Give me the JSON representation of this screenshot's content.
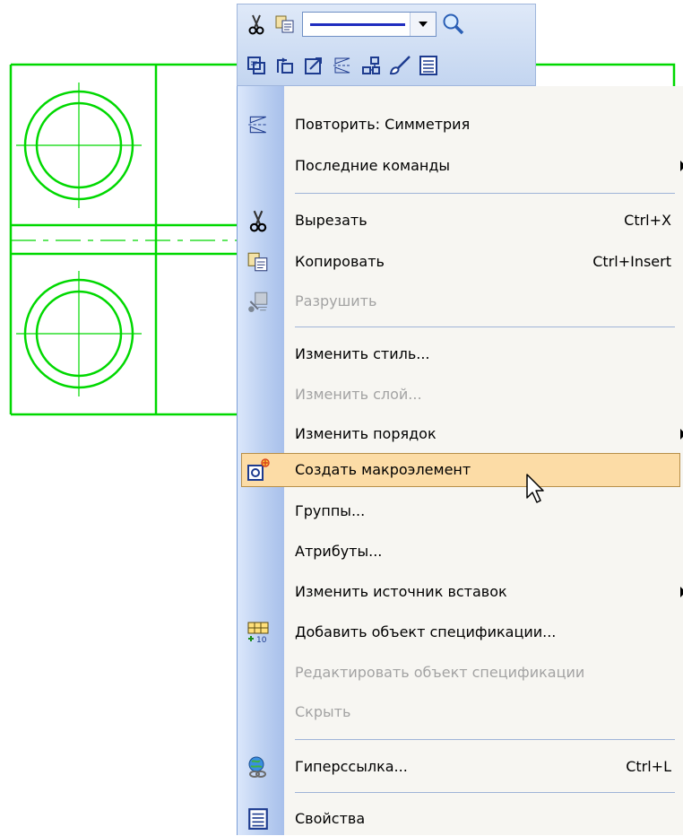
{
  "colors": {
    "drawing_line": "#00d800",
    "menu_background": "#f7f6f2",
    "gutter": "#bcd0f1",
    "highlight": "#fcdca6",
    "highlight_border": "#b78f4a",
    "disabled_text": "#a3a3a3",
    "toolbar": "#c9d9f2"
  },
  "toolbar": {
    "row1": [
      "cut-icon",
      "copy-icon",
      "line-style-combo",
      "zoom-icon"
    ],
    "row2": [
      "macro-object-icon",
      "group-icon",
      "scale-icon",
      "symmetry-icon",
      "array-icon",
      "style-brush-icon",
      "properties-icon"
    ]
  },
  "context_menu": {
    "items": [
      {
        "label": "Повторить: Симметрия",
        "icon": "symmetry-icon"
      },
      {
        "label": "Последние команды",
        "submenu": true
      },
      {
        "label": "Вырезать",
        "shortcut": "Ctrl+X",
        "icon": "cut-icon"
      },
      {
        "label": "Копировать",
        "shortcut": "Ctrl+Insert",
        "icon": "copy-icon"
      },
      {
        "label": "Разрушить",
        "disabled": true,
        "icon": "destroy-icon"
      },
      {
        "label": "Изменить стиль..."
      },
      {
        "label": "Изменить слой...",
        "disabled": true
      },
      {
        "label": "Изменить порядок",
        "submenu": true
      },
      {
        "label": "Создать макроэлемент",
        "highlighted": true,
        "icon": "macro-object-icon"
      },
      {
        "label": "Группы..."
      },
      {
        "label": "Атрибуты..."
      },
      {
        "label": "Изменить источник вставок",
        "submenu": true
      },
      {
        "label": "Добавить объект спецификации...",
        "icon": "specification-icon"
      },
      {
        "label": "Редактировать объект спецификации",
        "disabled": true
      },
      {
        "label": "Скрыть",
        "disabled": true
      },
      {
        "label": "Гиперссылка...",
        "shortcut": "Ctrl+L",
        "icon": "hyperlink-icon"
      },
      {
        "label": "Свойства",
        "icon": "properties-icon"
      }
    ]
  }
}
